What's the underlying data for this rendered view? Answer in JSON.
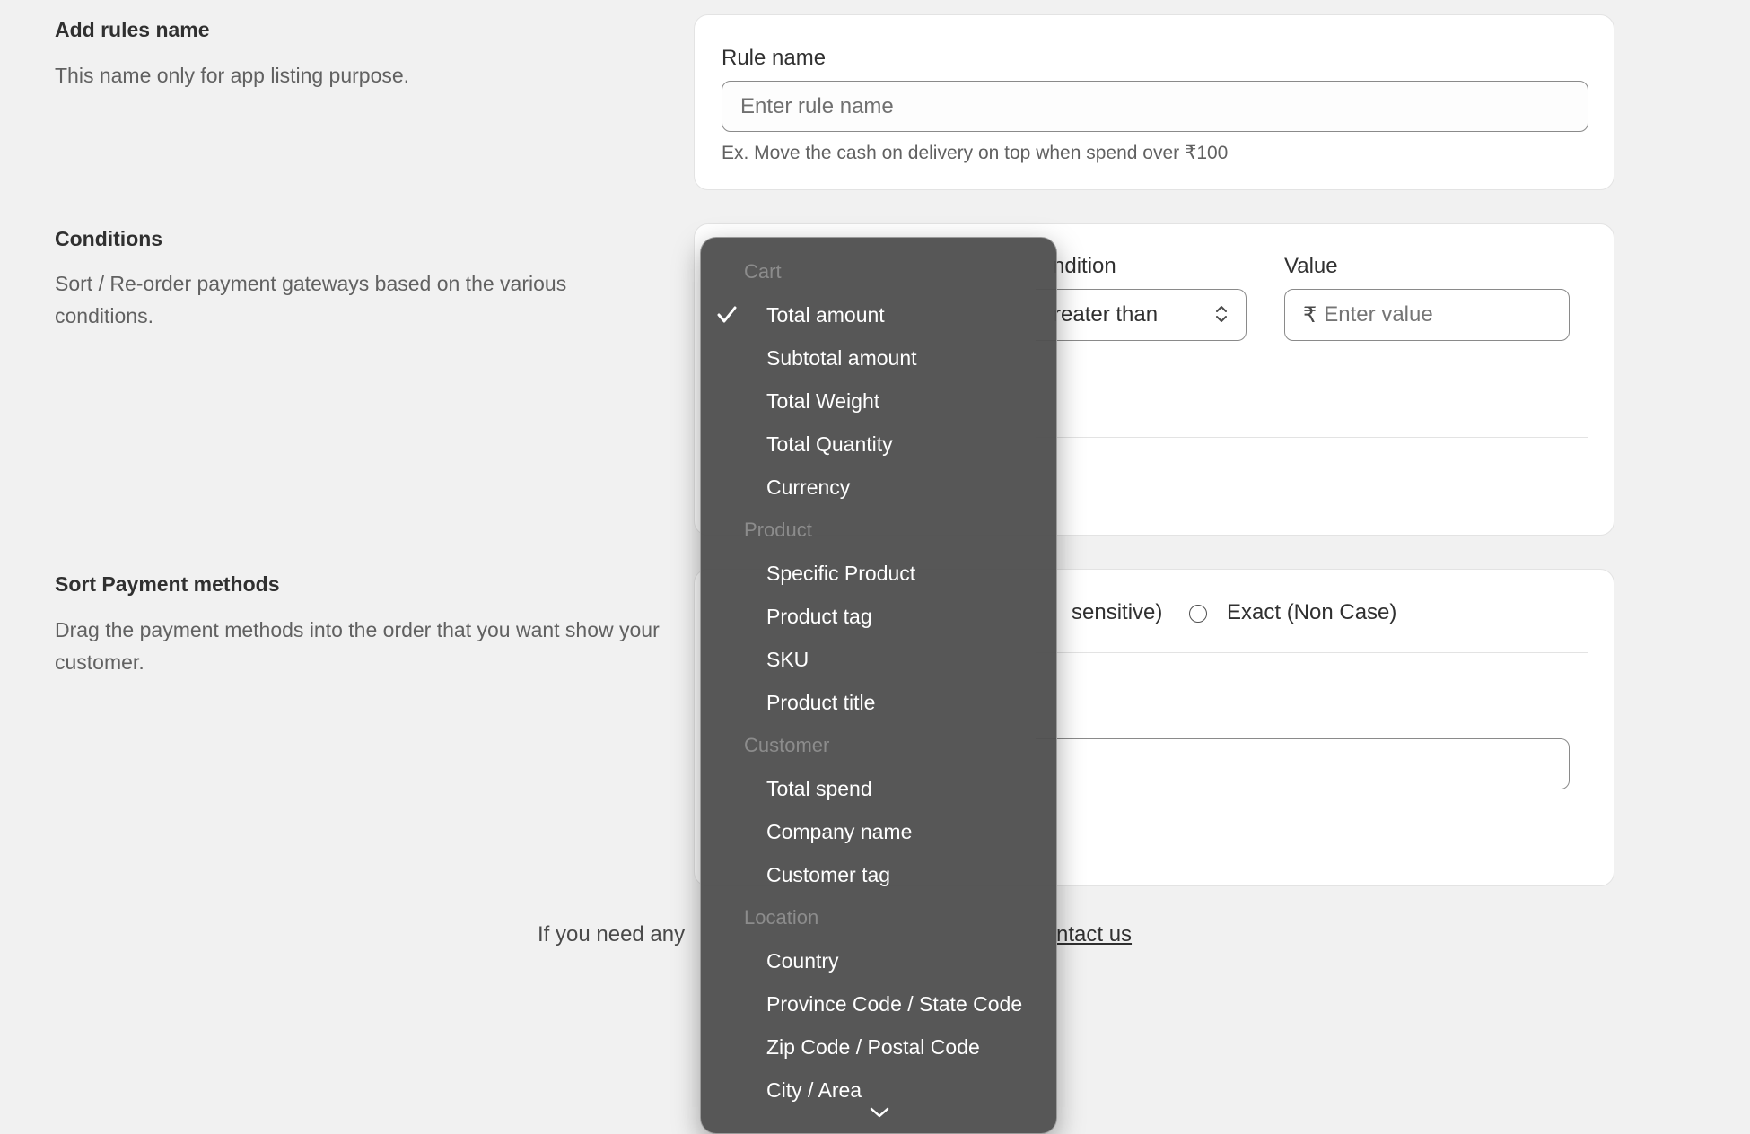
{
  "rules_section": {
    "title": "Add rules name",
    "description": "This name only for app listing purpose.",
    "rule_name_label": "Rule name",
    "rule_name_placeholder": "Enter rule name",
    "rule_name_help": "Ex. Move the cash on delivery on top when spend over ₹100"
  },
  "conditions_section": {
    "title": "Conditions",
    "description": "Sort / Re-order payment gateways based on the various conditions.",
    "condition_label_partial": "ndition",
    "condition_selected_partial": "reater than",
    "value_label": "Value",
    "value_prefix": "₹",
    "value_placeholder": "Enter value"
  },
  "sort_section": {
    "title": "Sort Payment methods",
    "description": "Drag the payment methods into the order that you want show your customer.",
    "match_option_partial": "sensitive)",
    "exact_option": "Exact (Non Case)"
  },
  "footer": {
    "text_partial": "If you need any",
    "link_partial": "ntact us"
  },
  "dropdown": {
    "groups": [
      {
        "label": "Cart",
        "items": [
          "Total amount",
          "Subtotal amount",
          "Total Weight",
          "Total Quantity",
          "Currency"
        ]
      },
      {
        "label": "Product",
        "items": [
          "Specific Product",
          "Product tag",
          "SKU",
          "Product title"
        ]
      },
      {
        "label": "Customer",
        "items": [
          "Total spend",
          "Company name",
          "Customer tag"
        ]
      },
      {
        "label": "Location",
        "items": [
          "Country",
          "Province Code / State Code",
          "Zip Code / Postal Code",
          "City / Area"
        ]
      }
    ],
    "selected": "Total amount",
    "check_icon": "checkmark-icon",
    "more_icon": "chevron-down-icon"
  }
}
